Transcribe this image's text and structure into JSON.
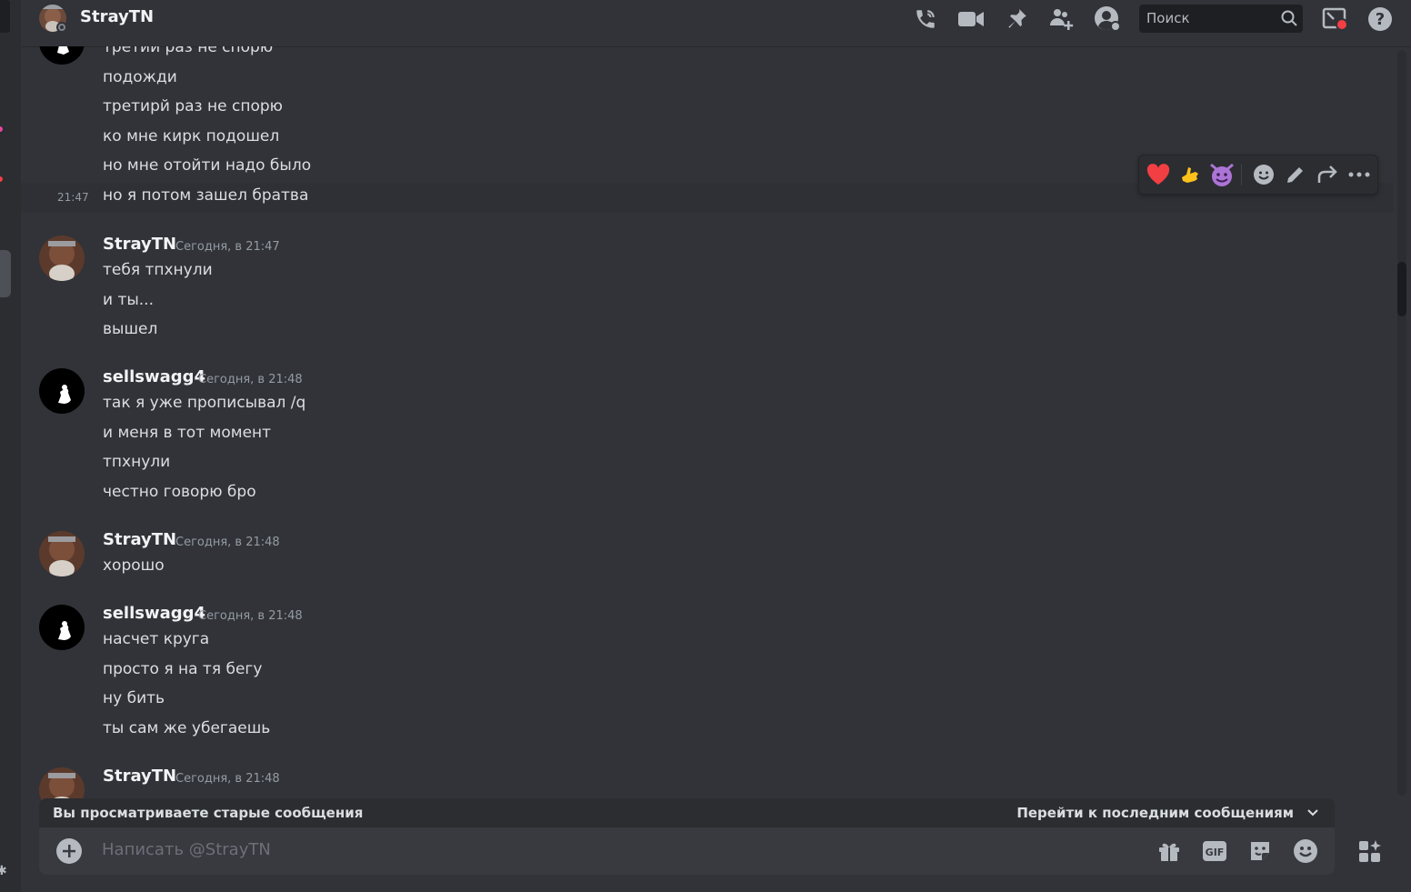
{
  "header": {
    "title": "StrayTN",
    "search_placeholder": "Поиск"
  },
  "messages": {
    "continuation_lines": [
      "третий раз не спорю",
      "подожди",
      "третирй раз не спорю",
      "ко мне кирк подошел",
      "но мне отойти надо было",
      "но я потом зашел братва"
    ],
    "hover_time": "21:47",
    "groups": [
      {
        "author": "StrayTN",
        "timestamp": "Сегодня, в 21:47",
        "lines": [
          "тебя тпхнули",
          "и ты...",
          "вышел"
        ]
      },
      {
        "author": "sellswagg4",
        "timestamp": "Сегодня, в 21:48",
        "lines": [
          "так я уже прописывал /q",
          "и меня в тот момент",
          "тпхнули",
          "честно говорю бро"
        ]
      },
      {
        "author": "StrayTN",
        "timestamp": "Сегодня, в 21:48",
        "lines": [
          "хорошо"
        ]
      },
      {
        "author": "sellswagg4",
        "timestamp": "Сегодня, в 21:48",
        "lines": [
          "насчет круга",
          "просто я на тя бегу",
          "ну бить",
          "ты сам же убегаешь"
        ]
      },
      {
        "author": "StrayTN",
        "timestamp": "Сегодня, в 21:48",
        "lines": []
      }
    ]
  },
  "banner": {
    "left": "Вы просматриваете старые сообщения",
    "right": "Перейти к последним сообщениям"
  },
  "composer": {
    "placeholder": "Написать @StrayTN"
  },
  "colors": {
    "background": "#313338",
    "composer": "#383a40",
    "heart": "#f23f43",
    "status_red": "#f23f43"
  }
}
